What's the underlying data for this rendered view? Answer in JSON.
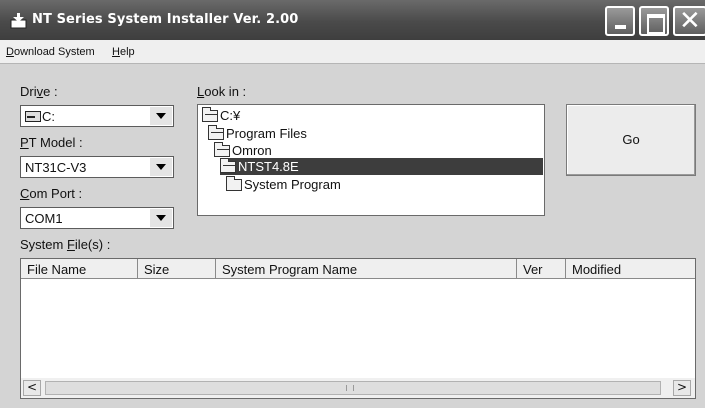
{
  "window": {
    "title": "NT Series System Installer Ver. 2.00",
    "controls": {
      "minimize": "minimize",
      "maximize": "maximize",
      "close": "close"
    }
  },
  "menu": {
    "items": [
      {
        "label": "Download System",
        "mnemonic": "D"
      },
      {
        "label": "Help",
        "mnemonic": "H"
      }
    ]
  },
  "drive": {
    "label": "Drive :",
    "value": "C:",
    "icon": "drive-icon"
  },
  "pt_model": {
    "label": "PT Model :",
    "value": "NT31C-V3"
  },
  "com_port": {
    "label": "Com Port :",
    "value": "COM1"
  },
  "look_in": {
    "label": "Look in :",
    "tree": [
      {
        "label": "C:¥",
        "depth": 0,
        "open": true,
        "selected": false
      },
      {
        "label": "Program Files",
        "depth": 1,
        "open": true,
        "selected": false
      },
      {
        "label": "Omron",
        "depth": 2,
        "open": true,
        "selected": false
      },
      {
        "label": "NTST4.8E",
        "depth": 3,
        "open": true,
        "selected": true
      },
      {
        "label": "System Program",
        "depth": 4,
        "open": false,
        "selected": false
      }
    ]
  },
  "go_button": {
    "label": "Go"
  },
  "system_files": {
    "label": "System File(s) :",
    "columns": [
      "File Name",
      "Size",
      "System Program Name",
      "Ver",
      "Modified"
    ],
    "rows": []
  },
  "scrollbar": {
    "left_arrow": "<",
    "right_arrow": ">"
  }
}
